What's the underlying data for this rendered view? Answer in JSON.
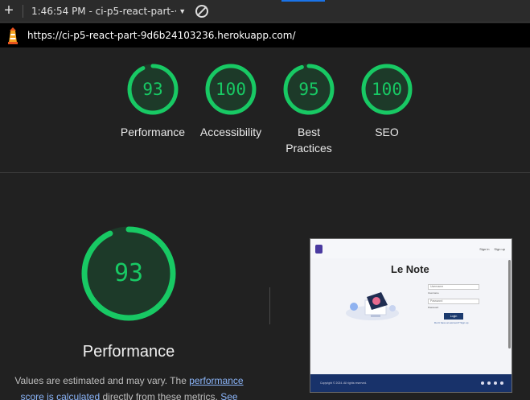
{
  "toolbar": {
    "session_label": "1:46:54 PM - ci-p5-react-part-·",
    "caret": "▼",
    "plus_icon": "plus-icon",
    "clear_icon": "block-icon"
  },
  "url_bar": {
    "url": "https://ci-p5-react-part-9d6b24103236.herokuapp.com/",
    "icon": "lighthouse-icon"
  },
  "scores": [
    {
      "value": "93",
      "label": "Performance",
      "fraction": 0.93
    },
    {
      "value": "100",
      "label": "Accessibility",
      "fraction": 1.0
    },
    {
      "value": "95",
      "label": "Best Practices",
      "fraction": 0.95
    },
    {
      "value": "100",
      "label": "SEO",
      "fraction": 1.0
    }
  ],
  "score_color": "#18c964",
  "detail": {
    "value": "93",
    "fraction": 0.93,
    "title": "Performance",
    "desc_pre": "Values are estimated and may vary. The ",
    "desc_link1": "performance score is calculated",
    "desc_mid": " directly from these metrics. ",
    "desc_link2": "See"
  },
  "thumbnail": {
    "app_title": "Le Note",
    "nav_signin": "Sign in",
    "nav_signup": "Sign up",
    "username_placeholder": "Username",
    "username_label": "Username",
    "password_placeholder": "Password",
    "password_label": "Password",
    "login_button": "Login",
    "signup_prompt": "Don't have an account? Sign up",
    "footer_copy": "Copyright © 2024. All rights reserved."
  }
}
